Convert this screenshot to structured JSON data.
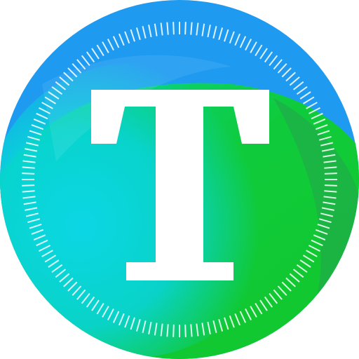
{
  "logo": {
    "letter": "T",
    "icon": "letter-t-coin-icon",
    "colors": {
      "blue": "#1E9BF0",
      "cyan": "#0BD2F2",
      "green": "#11C72C",
      "dark_green": "#1FAE4A",
      "letter": "#FFFFFF",
      "ticks": "#FFFFFF"
    }
  }
}
